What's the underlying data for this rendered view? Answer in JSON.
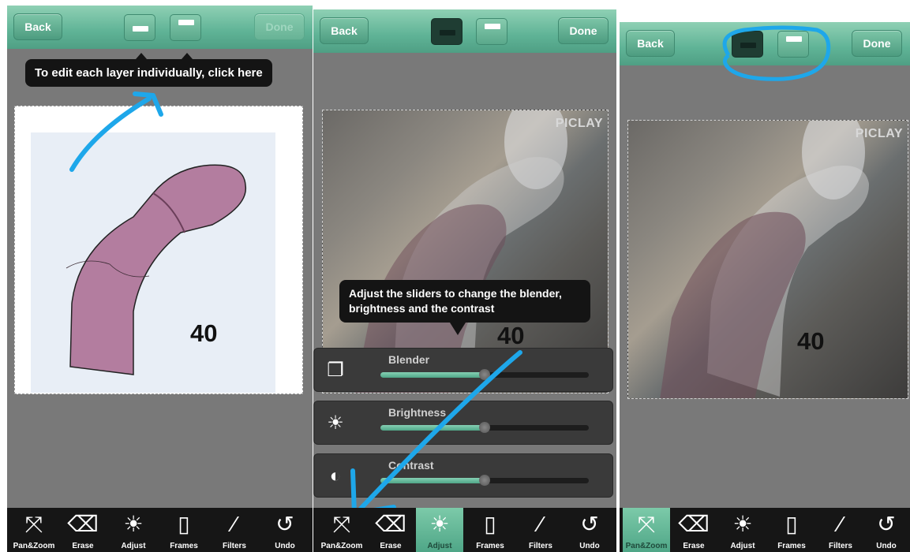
{
  "colors": {
    "topbar": "#5fb396",
    "toolbar": "#161616",
    "active_tool": "#5fb396",
    "annotation": "#1ea7ea",
    "tooltip": "#141414"
  },
  "panel1": {
    "back": "Back",
    "done": "Done",
    "tooltip": "To edit each layer individually, click here",
    "number": "40"
  },
  "panel2": {
    "back": "Back",
    "done": "Done",
    "watermark": "PICLAY",
    "tooltip": "Adjust the sliders to change the blender, brightness and the contrast",
    "number": "40",
    "sliders": [
      {
        "label": "Blender",
        "icon": "layers-icon",
        "value": 0.5
      },
      {
        "label": "Brightness",
        "icon": "sun-icon",
        "value": 0.5
      },
      {
        "label": "Contrast",
        "icon": "contrast-icon",
        "value": 0.5
      }
    ]
  },
  "panel3": {
    "back": "Back",
    "done": "Done",
    "watermark": "PICLAY",
    "number": "40"
  },
  "toolbar": {
    "pan_zoom": "Pan&Zoom",
    "erase": "Erase",
    "adjust": "Adjust",
    "frames": "Frames",
    "filters": "Filters",
    "undo": "Undo"
  }
}
